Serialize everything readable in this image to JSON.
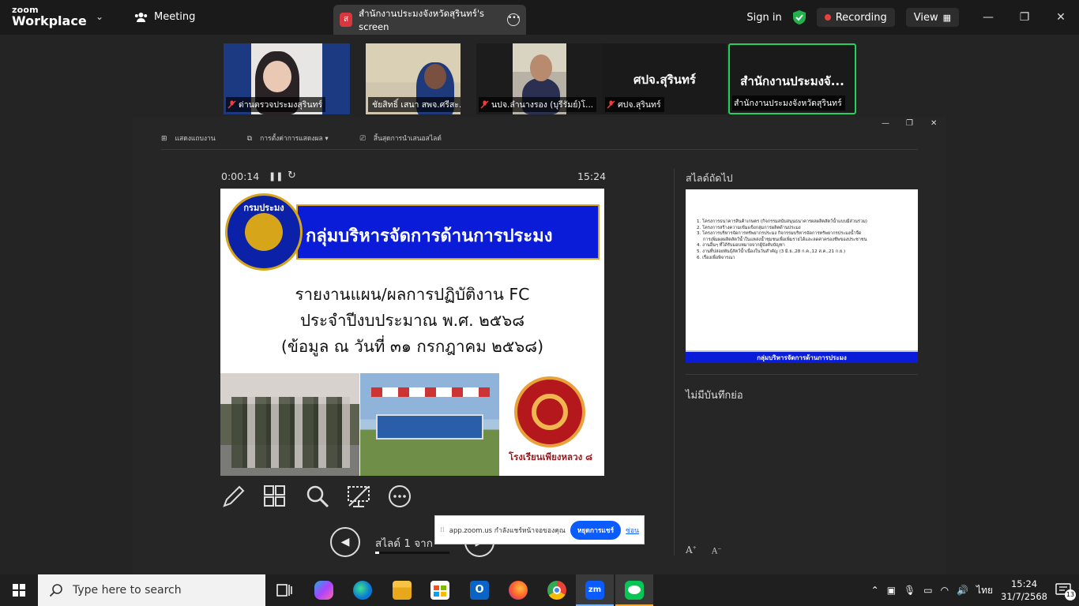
{
  "app": {
    "brand_small": "zoom",
    "brand_large": "Workplace",
    "meeting_label": "Meeting",
    "share_tab_initial": "ส",
    "share_tab_label": "สำนักงานประมงจังหวัดสุรินทร์'s screen",
    "sign_in": "Sign in",
    "recording": "Recording",
    "view": "View",
    "accent_color": "#0b5cff",
    "recording_color": "#e8423f"
  },
  "participants": [
    {
      "name": "ด่านตรวจประมงสุรินทร์",
      "muted": true,
      "video": true
    },
    {
      "name": "ชัยสิทธิ์ เสนา สพจ.ศรีสะ...",
      "muted": true,
      "video": true
    },
    {
      "name": "นปจ.ลำนางรอง (บุรีรัมย์)โ...",
      "muted": true,
      "video": true
    },
    {
      "name": "ศปจ.สุรินทร์",
      "muted": true,
      "video": false,
      "display_name": "ศปจ.สุรินทร์"
    },
    {
      "name": "สำนักงานประมงจังหวัดสุรินทร์",
      "muted": false,
      "video": false,
      "display_name": "สำนักงานประมงจั...",
      "active_speaker": true
    }
  ],
  "presenter": {
    "toolbar": [
      "แสดงแถบงาน",
      "การตั้งค่าการแสดงผล ▾",
      "สิ้นสุดการนำเสนอสไลด์"
    ],
    "elapsed": "0:00:14",
    "clock": "15:24",
    "current_slide": {
      "header": "กลุ่มบริหารจัดการด้านการประมง",
      "seal_text": "กรมประมง",
      "title_lines": [
        "รายงานแผน/ผลการปฏิบัติงาน FC",
        "ประจำปีงบประมาณ พ.ศ. ๒๕๖๘",
        "(ข้อมูล ณ วันที่ ๓๑ กรกฎาคม ๒๕๖๘)"
      ],
      "emblem_caption": "โรงเรียนเพียงหลวง ๘"
    },
    "slide_counter": "สไลด์ 1 จาก",
    "progress": 0.05,
    "next_label": "สไลด์ถัดไป",
    "next_slide": {
      "items": [
        "1. โครงการธนาคารสินค้าเกษตร (กิจกรรมสนับสนุนธนาคารผลผลิตสัตว์น้ำแบบมีส่วนร่วม)",
        "2. โครงการสร้างความเข้มแข็งกลุ่มการผลิตด้านประมง",
        "3. โครงการบริหารจัดการทรัพยากรประมง กิจกรรมบริหารจัดการทรัพยากรประมงน้ำจืด",
        "   การเพิ่มผลผลิตสัตว์น้ำในแหล่งน้ำชุมชนเพื่อเพิ่มรายได้และลดค่าครองชีพของประชาชน",
        "4. งานอื่นๆ ที่ได้รับมอบหมายจากผู้บังคับบัญชา",
        "5. งานที่ปล่อยพันธุ์สัตว์น้ำเนื่องในวันสำคัญ (3 มิ.ย.,28 ก.ค.,12 ส.ค.,21 ก.ย.)",
        "6. เรื่องเพื่อพิจารณา"
      ],
      "banner": "กลุ่มบริหารจัดการด้านการประมง"
    },
    "notes": "ไม่มีบันทึกย่อ"
  },
  "share_bar": {
    "message": "app.zoom.us กำลังแชร์หน้าจอของคุณ",
    "stop_label": "หยุดการแชร์",
    "hide_label": "ซ่อน"
  },
  "taskbar": {
    "search_placeholder": "Type here to search",
    "language": "ไทย",
    "time": "15:24",
    "date": "31/7/2568",
    "notification_count": "13"
  }
}
